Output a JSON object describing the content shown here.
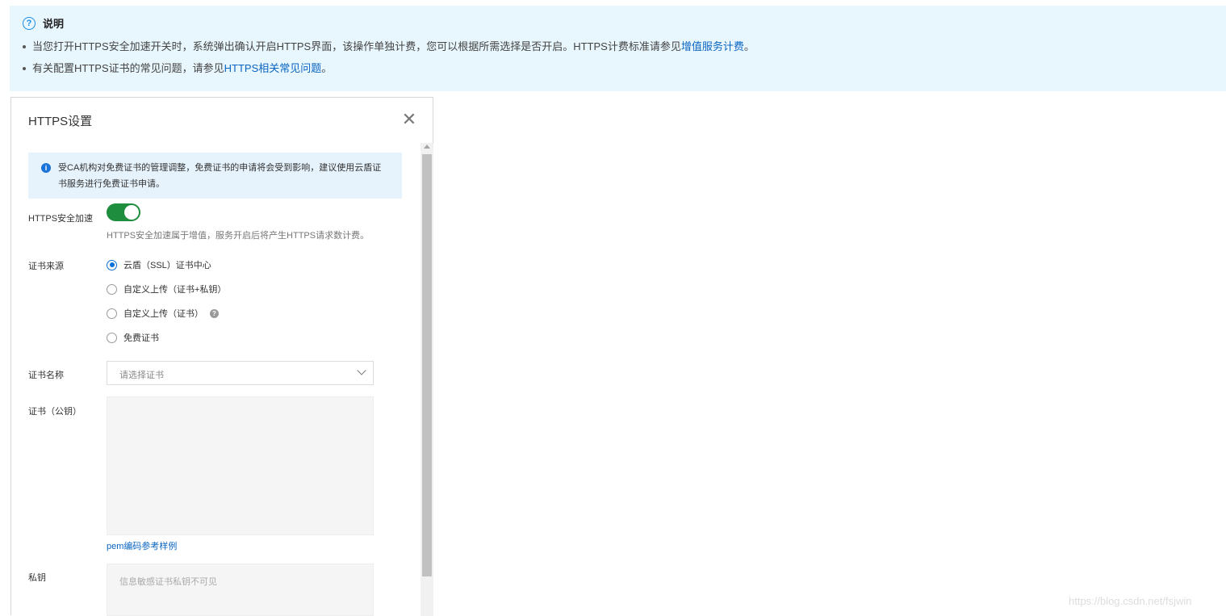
{
  "notice": {
    "icon": "question-circle-icon",
    "title": "说明",
    "items": [
      {
        "text": "当您打开HTTPS安全加速开关时，系统弹出确认开启HTTPS界面，该操作单独计费，您可以根据所需选择是否开启。HTTPS计费标准请参见",
        "link": "增值服务计费",
        "suffix": "。"
      },
      {
        "text": "有关配置HTTPS证书的常见问题，请参见",
        "link": "HTTPS相关常见问题",
        "suffix": "。"
      }
    ]
  },
  "panel": {
    "title": "HTTPS设置",
    "close_icon": "close-icon",
    "alert": {
      "icon": "info-icon",
      "text": "受CA机构对免费证书的管理调整，免费证书的申请将会受到影响，建议使用云盾证书服务进行免费证书申请。"
    },
    "https_accel": {
      "label": "HTTPS安全加速",
      "enabled": true,
      "hint": "HTTPS安全加速属于增值，服务开启后将产生HTTPS请求数计费。"
    },
    "cert_source": {
      "label": "证书来源",
      "options": [
        {
          "label": "云盾（SSL）证书中心",
          "checked": true
        },
        {
          "label": "自定义上传（证书+私钥）",
          "checked": false
        },
        {
          "label": "自定义上传（证书）",
          "checked": false,
          "help": "?"
        },
        {
          "label": "免费证书",
          "checked": false
        }
      ]
    },
    "cert_name": {
      "label": "证书名称",
      "placeholder": "请选择证书"
    },
    "public_key": {
      "label": "证书（公钥）",
      "value": "",
      "link": "pem编码参考样例"
    },
    "private_key": {
      "label": "私钥",
      "placeholder": "信息敏感证书私钥不可见"
    }
  },
  "colors": {
    "accent": "#0a65c2",
    "toggle_on": "#1e8e3e",
    "notice_bg": "#e8f6fd"
  },
  "watermark": "https://blog.csdn.net/fsjwin"
}
